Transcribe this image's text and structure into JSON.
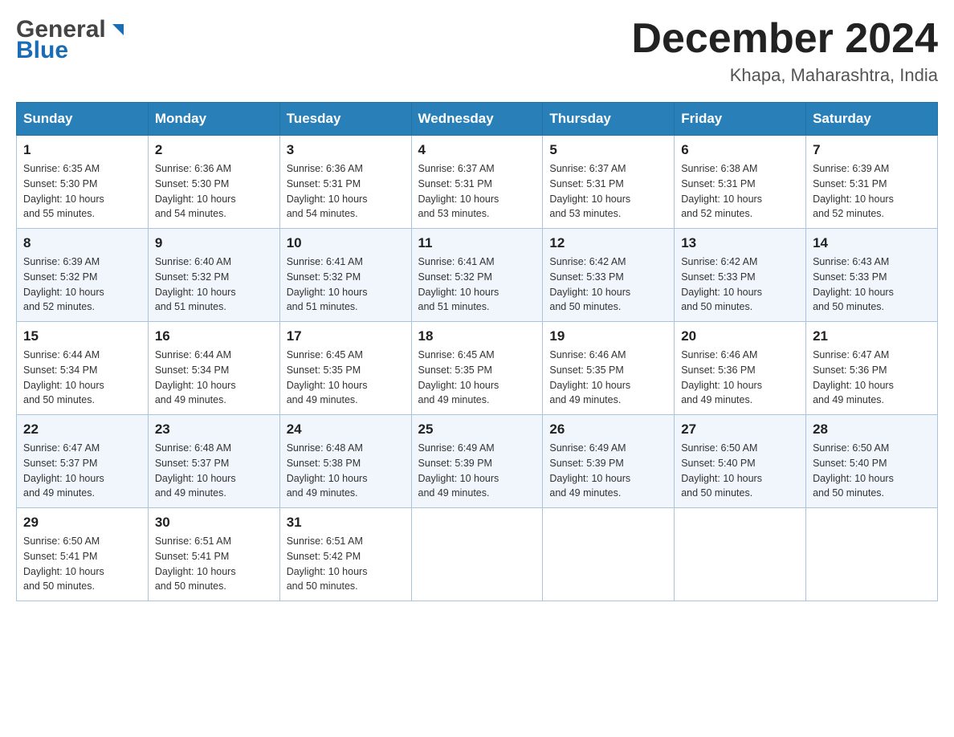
{
  "header": {
    "logo_general": "General",
    "logo_blue": "Blue",
    "month_title": "December 2024",
    "location": "Khapa, Maharashtra, India"
  },
  "weekdays": [
    "Sunday",
    "Monday",
    "Tuesday",
    "Wednesday",
    "Thursday",
    "Friday",
    "Saturday"
  ],
  "weeks": [
    [
      {
        "day": "1",
        "sunrise": "6:35 AM",
        "sunset": "5:30 PM",
        "daylight": "10 hours and 55 minutes."
      },
      {
        "day": "2",
        "sunrise": "6:36 AM",
        "sunset": "5:30 PM",
        "daylight": "10 hours and 54 minutes."
      },
      {
        "day": "3",
        "sunrise": "6:36 AM",
        "sunset": "5:31 PM",
        "daylight": "10 hours and 54 minutes."
      },
      {
        "day": "4",
        "sunrise": "6:37 AM",
        "sunset": "5:31 PM",
        "daylight": "10 hours and 53 minutes."
      },
      {
        "day": "5",
        "sunrise": "6:37 AM",
        "sunset": "5:31 PM",
        "daylight": "10 hours and 53 minutes."
      },
      {
        "day": "6",
        "sunrise": "6:38 AM",
        "sunset": "5:31 PM",
        "daylight": "10 hours and 52 minutes."
      },
      {
        "day": "7",
        "sunrise": "6:39 AM",
        "sunset": "5:31 PM",
        "daylight": "10 hours and 52 minutes."
      }
    ],
    [
      {
        "day": "8",
        "sunrise": "6:39 AM",
        "sunset": "5:32 PM",
        "daylight": "10 hours and 52 minutes."
      },
      {
        "day": "9",
        "sunrise": "6:40 AM",
        "sunset": "5:32 PM",
        "daylight": "10 hours and 51 minutes."
      },
      {
        "day": "10",
        "sunrise": "6:41 AM",
        "sunset": "5:32 PM",
        "daylight": "10 hours and 51 minutes."
      },
      {
        "day": "11",
        "sunrise": "6:41 AM",
        "sunset": "5:32 PM",
        "daylight": "10 hours and 51 minutes."
      },
      {
        "day": "12",
        "sunrise": "6:42 AM",
        "sunset": "5:33 PM",
        "daylight": "10 hours and 50 minutes."
      },
      {
        "day": "13",
        "sunrise": "6:42 AM",
        "sunset": "5:33 PM",
        "daylight": "10 hours and 50 minutes."
      },
      {
        "day": "14",
        "sunrise": "6:43 AM",
        "sunset": "5:33 PM",
        "daylight": "10 hours and 50 minutes."
      }
    ],
    [
      {
        "day": "15",
        "sunrise": "6:44 AM",
        "sunset": "5:34 PM",
        "daylight": "10 hours and 50 minutes."
      },
      {
        "day": "16",
        "sunrise": "6:44 AM",
        "sunset": "5:34 PM",
        "daylight": "10 hours and 49 minutes."
      },
      {
        "day": "17",
        "sunrise": "6:45 AM",
        "sunset": "5:35 PM",
        "daylight": "10 hours and 49 minutes."
      },
      {
        "day": "18",
        "sunrise": "6:45 AM",
        "sunset": "5:35 PM",
        "daylight": "10 hours and 49 minutes."
      },
      {
        "day": "19",
        "sunrise": "6:46 AM",
        "sunset": "5:35 PM",
        "daylight": "10 hours and 49 minutes."
      },
      {
        "day": "20",
        "sunrise": "6:46 AM",
        "sunset": "5:36 PM",
        "daylight": "10 hours and 49 minutes."
      },
      {
        "day": "21",
        "sunrise": "6:47 AM",
        "sunset": "5:36 PM",
        "daylight": "10 hours and 49 minutes."
      }
    ],
    [
      {
        "day": "22",
        "sunrise": "6:47 AM",
        "sunset": "5:37 PM",
        "daylight": "10 hours and 49 minutes."
      },
      {
        "day": "23",
        "sunrise": "6:48 AM",
        "sunset": "5:37 PM",
        "daylight": "10 hours and 49 minutes."
      },
      {
        "day": "24",
        "sunrise": "6:48 AM",
        "sunset": "5:38 PM",
        "daylight": "10 hours and 49 minutes."
      },
      {
        "day": "25",
        "sunrise": "6:49 AM",
        "sunset": "5:39 PM",
        "daylight": "10 hours and 49 minutes."
      },
      {
        "day": "26",
        "sunrise": "6:49 AM",
        "sunset": "5:39 PM",
        "daylight": "10 hours and 49 minutes."
      },
      {
        "day": "27",
        "sunrise": "6:50 AM",
        "sunset": "5:40 PM",
        "daylight": "10 hours and 50 minutes."
      },
      {
        "day": "28",
        "sunrise": "6:50 AM",
        "sunset": "5:40 PM",
        "daylight": "10 hours and 50 minutes."
      }
    ],
    [
      {
        "day": "29",
        "sunrise": "6:50 AM",
        "sunset": "5:41 PM",
        "daylight": "10 hours and 50 minutes."
      },
      {
        "day": "30",
        "sunrise": "6:51 AM",
        "sunset": "5:41 PM",
        "daylight": "10 hours and 50 minutes."
      },
      {
        "day": "31",
        "sunrise": "6:51 AM",
        "sunset": "5:42 PM",
        "daylight": "10 hours and 50 minutes."
      },
      null,
      null,
      null,
      null
    ]
  ],
  "labels": {
    "sunrise": "Sunrise:",
    "sunset": "Sunset:",
    "daylight": "Daylight:"
  }
}
